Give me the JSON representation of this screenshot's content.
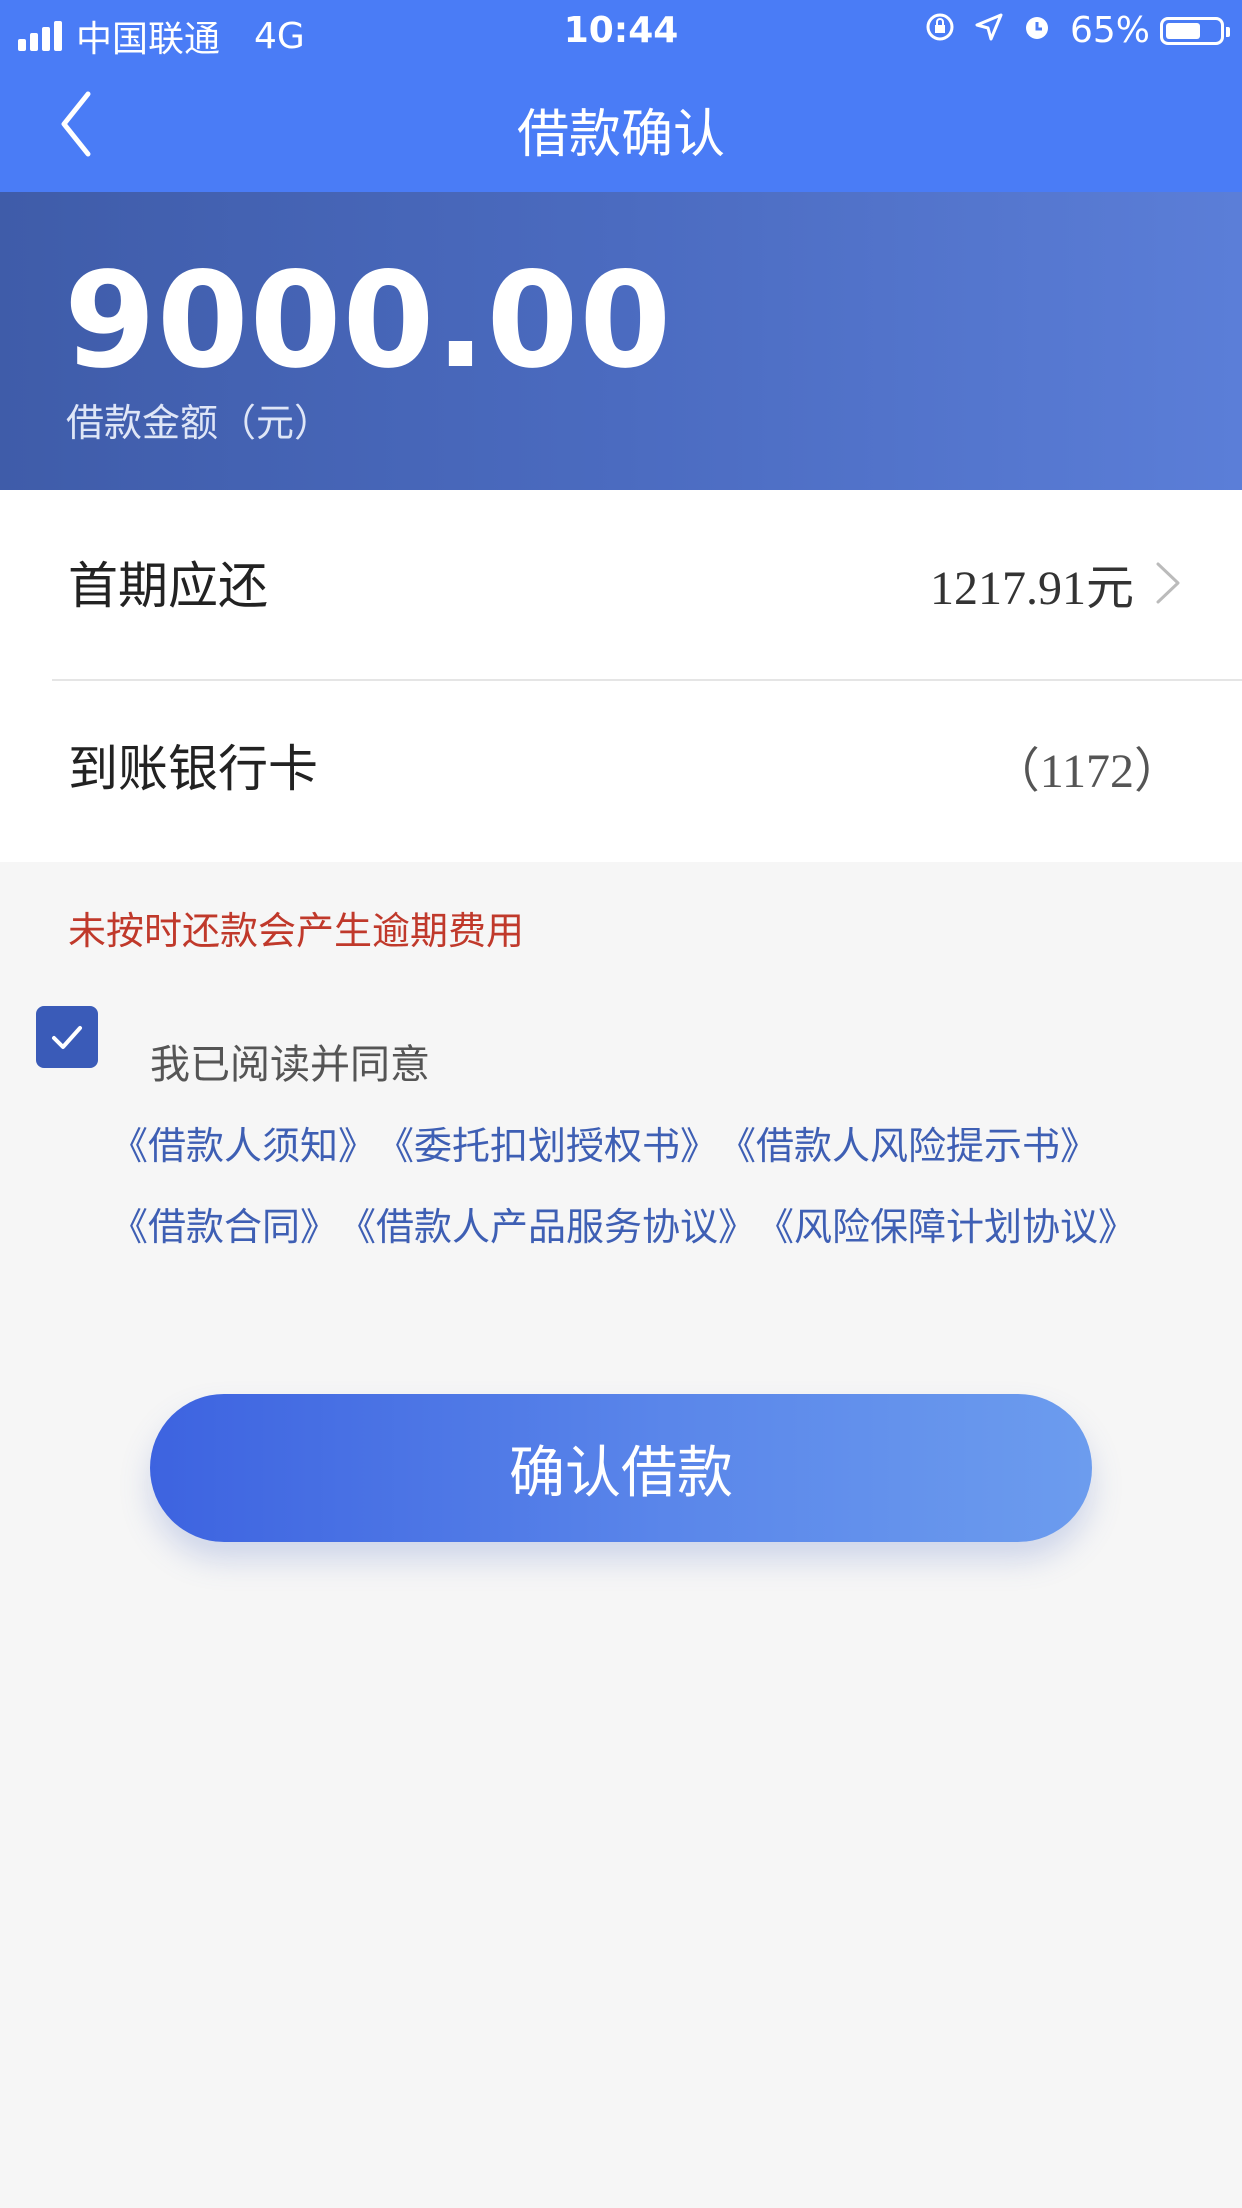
{
  "status_bar": {
    "carrier": "中国联通",
    "network": "4G",
    "time": "10:44",
    "battery": "65%",
    "battery_level": 0.65
  },
  "nav": {
    "title": "借款确认"
  },
  "loan": {
    "amount": "9000.00",
    "amount_label": "借款金额（元）"
  },
  "details": {
    "first_payment_label": "首期应还",
    "first_payment_value": "1217.91元",
    "bank_card_label": "到账银行卡",
    "bank_card_value": "（1172）"
  },
  "warning": "未按时还款会产生逾期费用",
  "agreement": {
    "checked": true,
    "agree_text": "我已阅读并同意",
    "line1": [
      "《借款人须知》",
      "《委托扣划授权书》",
      "《借款人风险提示书》"
    ],
    "line2": [
      "《借款合同》",
      "《借款人产品服务协议》",
      "《风险保障计划协议》"
    ]
  },
  "confirm_button": "确认借款",
  "colors": {
    "primary": "#4a7cf6",
    "warning": "#c0392b",
    "link": "#3e5fb4"
  }
}
